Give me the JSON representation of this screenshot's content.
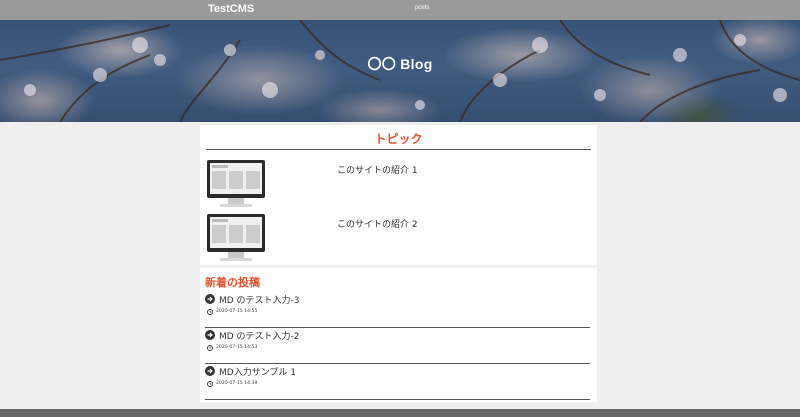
{
  "header": {
    "brand": "TestCMS",
    "nav_link": "posts"
  },
  "hero": {
    "title": "〇〇 Blog"
  },
  "topic": {
    "title": "トピック",
    "items": [
      {
        "label": "このサイトの紹介 1"
      },
      {
        "label": "このサイトの紹介 2"
      }
    ]
  },
  "recent": {
    "title": "新着の投稿",
    "posts": [
      {
        "title": "MD のテスト入力-3",
        "date": "2020-07-15 14:55"
      },
      {
        "title": "MD のテスト入力-2",
        "date": "2020-07-15 14:53"
      },
      {
        "title": "MD入力サンプル 1",
        "date": "2020-07-15 14:39"
      }
    ]
  },
  "colors": {
    "accent": "#e8532d",
    "topbar": "#9a9a9a",
    "footer": "#666666"
  }
}
